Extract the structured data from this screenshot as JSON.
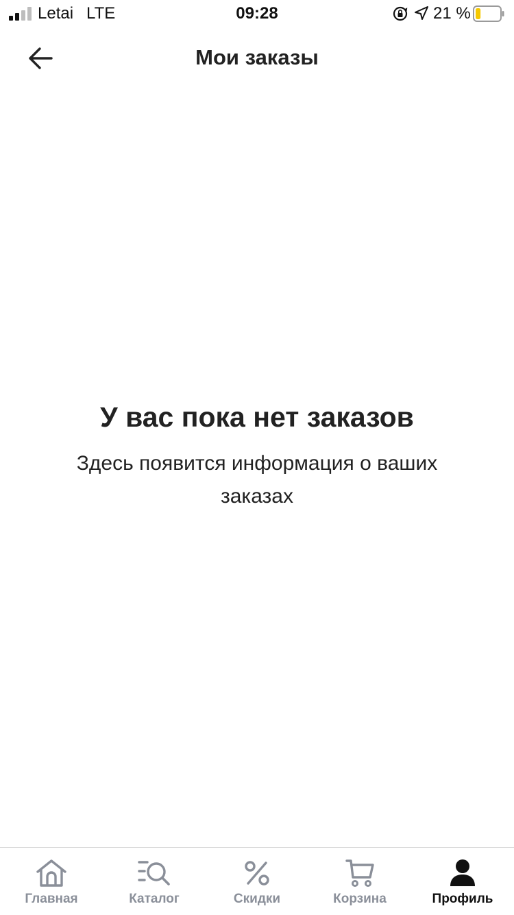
{
  "status_bar": {
    "carrier": "Letai",
    "network": "LTE",
    "time": "09:28",
    "battery_percent": "21 %",
    "battery_level": 0.21,
    "battery_color": "#f5c800"
  },
  "header": {
    "title": "Мои заказы",
    "back_icon": "arrow-left-icon"
  },
  "empty_state": {
    "title": "У вас пока нет заказов",
    "text": "Здесь появится информация о ваших заказах"
  },
  "tabbar": {
    "active_color": "#111111",
    "inactive_color": "#8a8f99",
    "items": [
      {
        "label": "Главная",
        "icon": "home-icon",
        "active": false
      },
      {
        "label": "Каталог",
        "icon": "catalog-search-icon",
        "active": false
      },
      {
        "label": "Скидки",
        "icon": "percent-icon",
        "active": false
      },
      {
        "label": "Корзина",
        "icon": "cart-icon",
        "active": false
      },
      {
        "label": "Профиль",
        "icon": "profile-icon",
        "active": true
      }
    ]
  }
}
